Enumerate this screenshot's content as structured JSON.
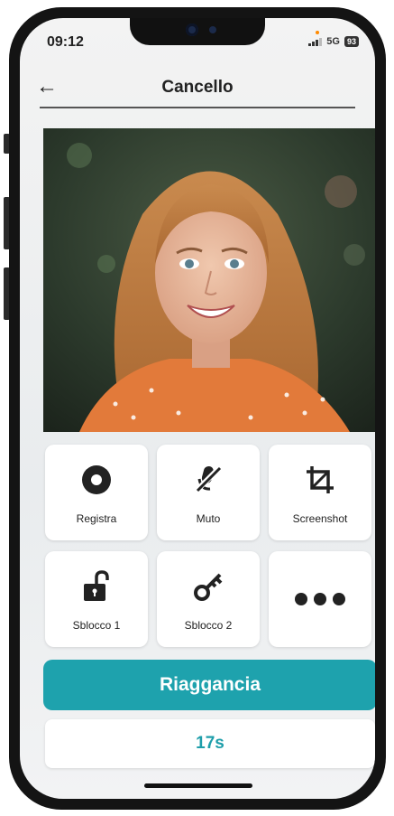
{
  "status_bar": {
    "time": "09:12",
    "network": "5G",
    "battery": "93"
  },
  "header": {
    "title": "Cancello"
  },
  "controls": [
    {
      "label": "Registra",
      "icon": "record-icon"
    },
    {
      "label": "Muto",
      "icon": "mic-off-icon"
    },
    {
      "label": "Screenshot",
      "icon": "crop-icon"
    },
    {
      "label": "Sblocco 1",
      "icon": "unlock-icon"
    },
    {
      "label": "Sblocco 2",
      "icon": "key-icon"
    },
    {
      "label": "",
      "icon": "more-icon"
    }
  ],
  "actions": {
    "hangup_label": "Riaggancia",
    "timer": "17s"
  },
  "colors": {
    "accent": "#1ea2ad",
    "timer_text": "#1e9eaa"
  }
}
